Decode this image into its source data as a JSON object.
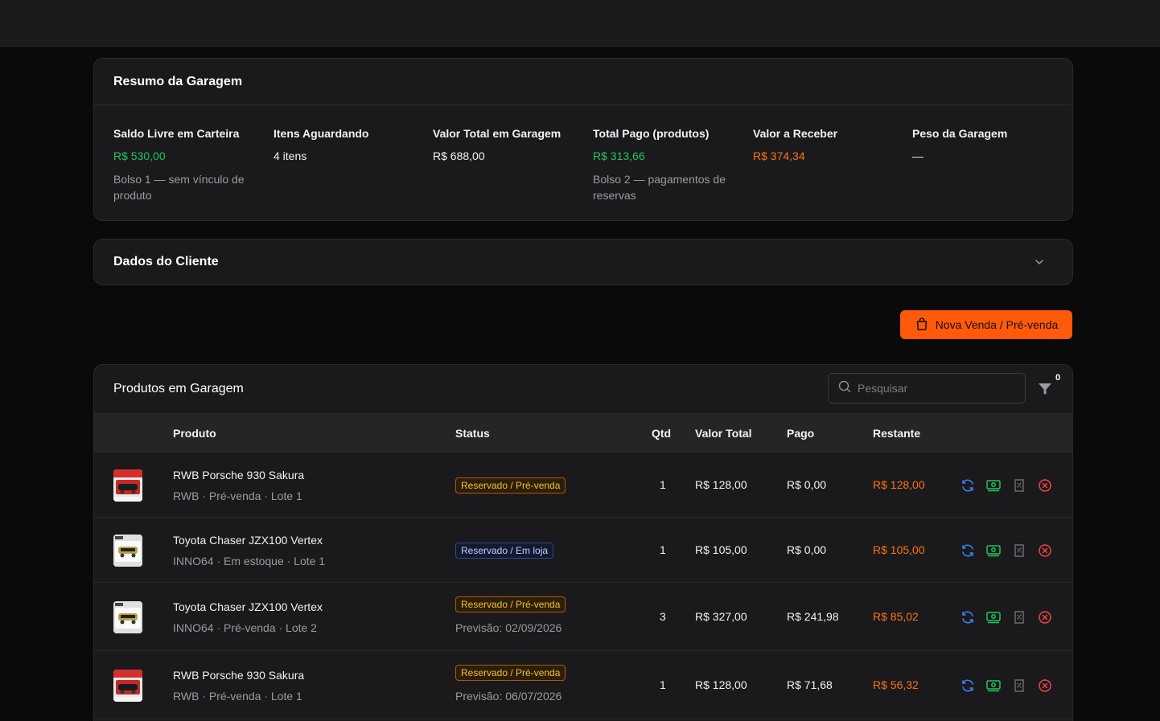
{
  "summary": {
    "title": "Resumo da Garagem",
    "stats": [
      {
        "label": "Saldo Livre em Carteira",
        "value": "R$ 530,00",
        "note": "Bolso 1 — sem vínculo de produto",
        "tone": "green"
      },
      {
        "label": "Itens Aguardando",
        "value": "4 itens",
        "note": "",
        "tone": "white"
      },
      {
        "label": "Valor Total em Garagem",
        "value": "R$ 688,00",
        "note": "",
        "tone": "white"
      },
      {
        "label": "Total Pago (produtos)",
        "value": "R$ 313,66",
        "note": "Bolso 2 — pagamentos de reservas",
        "tone": "green"
      },
      {
        "label": "Valor a Receber",
        "value": "R$ 374,34",
        "note": "",
        "tone": "orange"
      },
      {
        "label": "Peso da Garagem",
        "value": "—",
        "note": "",
        "tone": "white"
      }
    ]
  },
  "client": {
    "title": "Dados do Cliente"
  },
  "new_sale": {
    "label": "Nova Venda / Pré-venda"
  },
  "products": {
    "title": "Produtos em Garagem",
    "search_placeholder": "Pesquisar",
    "filter_count": "0",
    "columns": {
      "product": "Produto",
      "status": "Status",
      "qty": "Qtd",
      "total": "Valor Total",
      "paid": "Pago",
      "remaining": "Restante"
    },
    "rows": [
      {
        "name": "RWB Porsche 930 Sakura",
        "meta": "RWB · Pré-venda · Lote 1",
        "status": "Reservado / Pré-venda",
        "status_kind": "pre",
        "forecast": "",
        "qty": "1",
        "total": "R$ 128,00",
        "paid": "R$ 0,00",
        "remaining": "R$ 128,00",
        "thumb": "porsche"
      },
      {
        "name": "Toyota Chaser JZX100 Vertex",
        "meta": "INNO64 · Em estoque · Lote 1",
        "status": "Reservado / Em loja",
        "status_kind": "store",
        "forecast": "",
        "qty": "1",
        "total": "R$ 105,00",
        "paid": "R$ 0,00",
        "remaining": "R$ 105,00",
        "thumb": "toyota"
      },
      {
        "name": "Toyota Chaser JZX100 Vertex",
        "meta": "INNO64 · Pré-venda · Lote 2",
        "status": "Reservado / Pré-venda",
        "status_kind": "pre",
        "forecast": "Previsão: 02/09/2026",
        "qty": "3",
        "total": "R$ 327,00",
        "paid": "R$ 241,98",
        "remaining": "R$ 85,02",
        "thumb": "toyota"
      },
      {
        "name": "RWB Porsche 930 Sakura",
        "meta": "RWB · Pré-venda · Lote 1",
        "status": "Reservado / Pré-venda",
        "status_kind": "pre",
        "forecast": "Previsão: 06/07/2026",
        "qty": "1",
        "total": "R$ 128,00",
        "paid": "R$ 71,68",
        "remaining": "R$ 56,32",
        "thumb": "porsche"
      }
    ]
  },
  "colors": {
    "accent": "#ff5a0a",
    "green": "#22c55e",
    "orange": "#f97316",
    "blue": "#3b82f6",
    "red": "#ef4444"
  }
}
